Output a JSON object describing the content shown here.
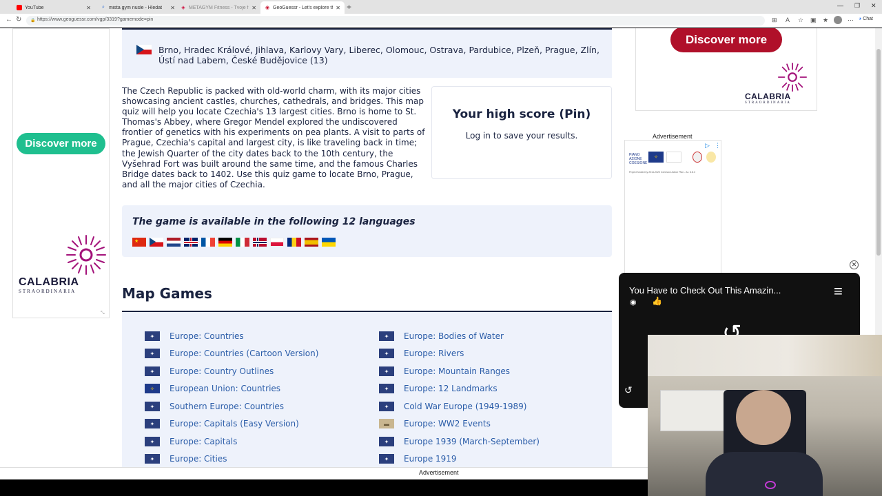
{
  "browser": {
    "tabs": [
      {
        "title": "YouTube",
        "icon": "youtube-icon",
        "active": false
      },
      {
        "title": "mista gym nusle - Hledat",
        "icon": "search-icon",
        "active": false
      },
      {
        "title": "METAGYM Fitness - Tvoje fitko za...",
        "icon": "gym-icon",
        "active": false
      },
      {
        "title": "GeoGuessr - Let's explore the wor...",
        "icon": "geoguessr-icon",
        "active": true
      }
    ],
    "url": "https://www.geoguessr.com/vgp/3319?gamemode=pin",
    "chat_label": "Chat"
  },
  "ads": {
    "left_cta": "Discover more",
    "right_cta": "Discover more",
    "brand": "CALABRIA",
    "brand_sub": "STRAORDINARIA",
    "advertisement_label": "Advertisement",
    "bottom_label": "Advertisement",
    "eu_text": "Project funded by 2014-2020 Cohesion Action Plan - Ax. 6.8.3"
  },
  "cities": {
    "text": "Brno, Hradec Králové, Jihlava, Karlovy Vary, Liberec, Olomouc, Ostrava, Pardubice, Plzeň, Prague, Zlín, Ústí nad Labem, České Budějovice (13)"
  },
  "description": "The Czech Republic is packed with old-world charm, with its major cities showcasing ancient castles, churches, cathedrals, and bridges. This map quiz will help you locate Czechia's 13 largest cities. Brno is home to St. Thomas's Abbey, where Gregor Mendel explored the undiscovered frontier of genetics with his experiments on pea plants. A visit to parts of Prague, Czechia's capital and largest city, is like traveling back in time; the Jewish Quarter of the city dates back to the 10th century, the Vyšehrad Fort was built around the same time, and the famous Charles Bridge dates back to 1402. Use this quiz game to locate Brno, Prague, and all the major cities of Czechia.",
  "highscore": {
    "title": "Your high score (Pin)",
    "subtitle": "Log in to save your results."
  },
  "languages": {
    "title": "The game is available in the following 12 languages",
    "flags": [
      "china",
      "czech",
      "netherlands",
      "uk",
      "france",
      "germany",
      "italy",
      "norway",
      "poland",
      "romania",
      "spain",
      "ukraine"
    ]
  },
  "map_games": {
    "title": "Map Games",
    "left": [
      "Europe: Countries",
      "Europe: Countries (Cartoon Version)",
      "Europe: Country Outlines",
      "European Union: Countries",
      "Southern Europe: Countries",
      "Europe: Capitals (Easy Version)",
      "Europe: Capitals",
      "Europe: Cities"
    ],
    "right": [
      "Europe: Bodies of Water",
      "Europe: Rivers",
      "Europe: Mountain Ranges",
      "Europe: 12 Landmarks",
      "Cold War Europe (1949-1989)",
      "Europe: WW2 Events",
      "Europe 1939 (March-September)",
      "Europe 1919"
    ]
  },
  "video": {
    "title": "You Have to Check Out This Amazin..."
  }
}
